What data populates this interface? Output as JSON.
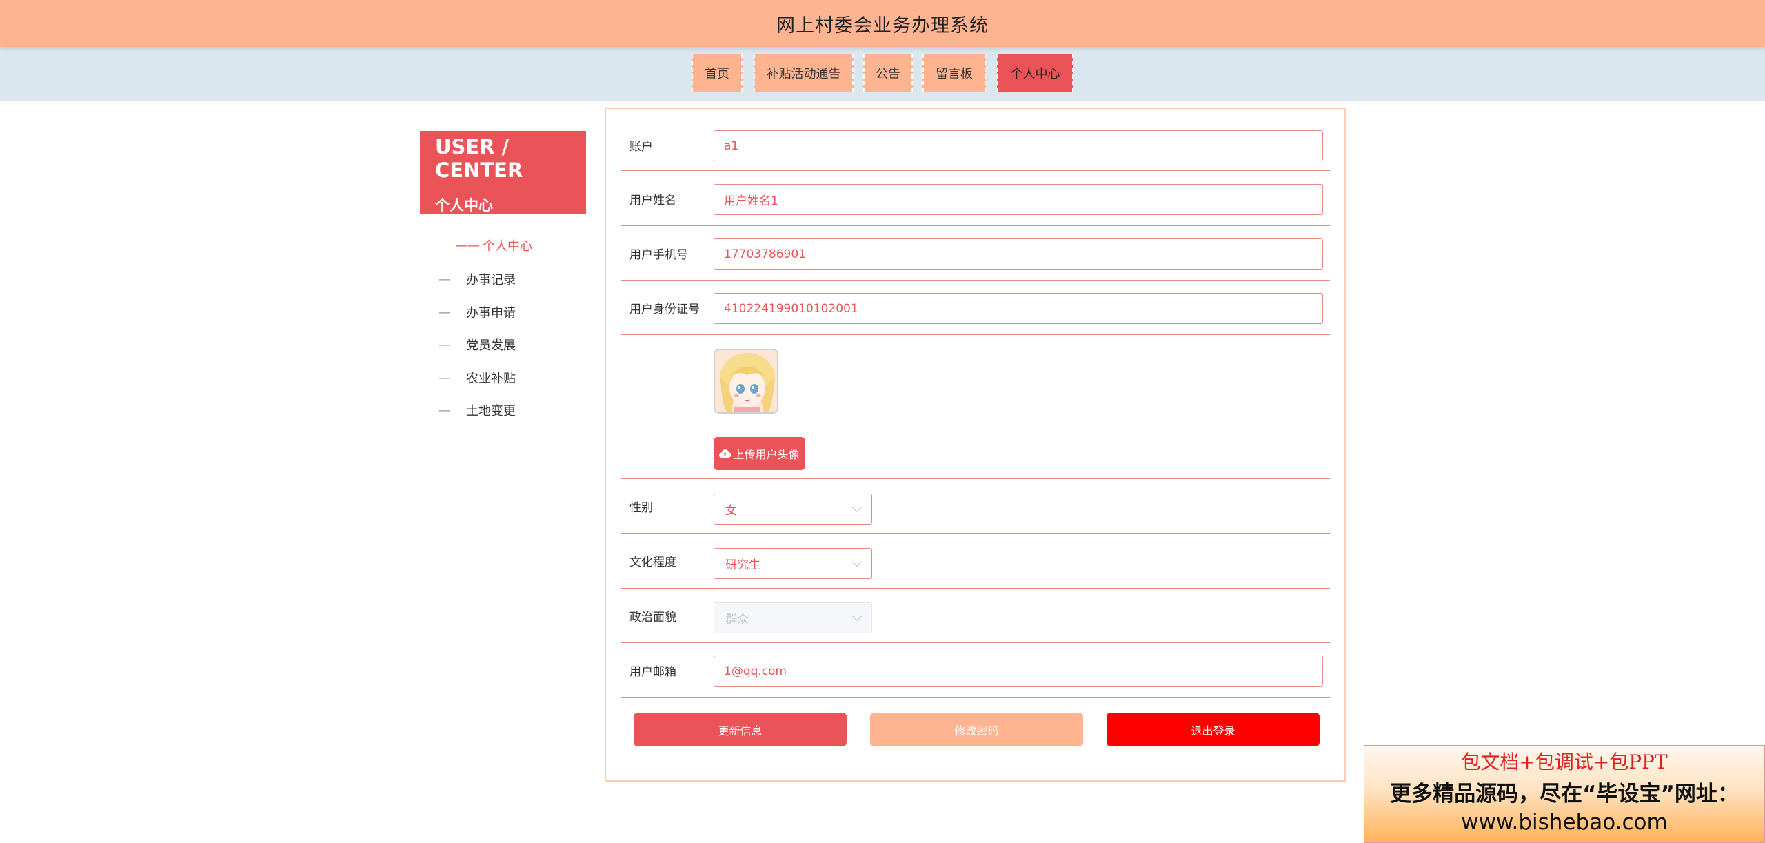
{
  "header": {
    "title": "网上村委会业务办理系统"
  },
  "nav": {
    "items": [
      {
        "label": "首页"
      },
      {
        "label": "补贴活动通告"
      },
      {
        "label": "公告"
      },
      {
        "label": "留言板"
      },
      {
        "label": "个人中心",
        "active": true
      }
    ]
  },
  "sidebar": {
    "banner_en": "USER / CENTER",
    "banner_zh": "个人中心",
    "active_prefix": "——",
    "dash": "—",
    "items": [
      {
        "label": "个人中心",
        "active": true
      },
      {
        "label": "办事记录"
      },
      {
        "label": "办事申请"
      },
      {
        "label": "党员发展"
      },
      {
        "label": "农业补贴"
      },
      {
        "label": "土地变更"
      }
    ]
  },
  "form": {
    "account": {
      "label": "账户",
      "value": "a1"
    },
    "name": {
      "label": "用户姓名",
      "value": "用户姓名1"
    },
    "phone": {
      "label": "用户手机号",
      "value": "17703786901"
    },
    "id_card": {
      "label": "用户身份证号",
      "value": "410224199010102001"
    },
    "upload_label": "上传用户头像",
    "gender": {
      "label": "性别",
      "value": "女"
    },
    "education": {
      "label": "文化程度",
      "value": "研究生"
    },
    "politics": {
      "label": "政治面貌",
      "value": "群众",
      "disabled": true
    },
    "email": {
      "label": "用户邮箱",
      "value": "1@qq.com"
    }
  },
  "buttons": {
    "update": "更新信息",
    "change_password": "修改密码",
    "logout": "退出登录"
  },
  "colors": {
    "header": "#ffb491",
    "nav_bg": "#dbe7ee",
    "accent": "#ea5458",
    "logout": "#ff0000"
  },
  "watermark": {
    "line1": "包文档+包调试+包PPT",
    "line2": "更多精品源码，尽在“毕设宝”网址：",
    "line3": "www.bishebao.com"
  }
}
